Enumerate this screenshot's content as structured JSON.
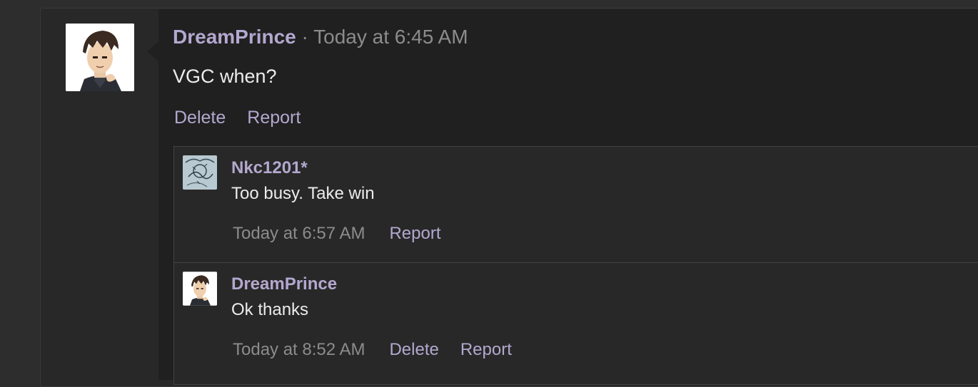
{
  "post": {
    "author": "DreamPrince",
    "separator": " · ",
    "time": "Today at 6:45 AM",
    "text": "VGC when?",
    "actions": {
      "delete": "Delete",
      "report": "Report"
    }
  },
  "replies": [
    {
      "author": "Nkc1201*",
      "text": "Too busy. Take win",
      "time": "Today at 6:57 AM",
      "actions": {
        "report": "Report"
      }
    },
    {
      "author": "DreamPrince",
      "text": "Ok thanks",
      "time": "Today at 8:52 AM",
      "actions": {
        "delete": "Delete",
        "report": "Report"
      }
    }
  ],
  "colors": {
    "username": "#b3a8cf",
    "link": "#b3a8cf",
    "timestamp": "#8c8c8c",
    "text": "#ececec",
    "background": "#202020"
  },
  "icons": {
    "post_avatar": "anime-character-avatar",
    "reply_1_avatar": "sketch-art-avatar",
    "reply_2_avatar": "anime-character-avatar"
  }
}
